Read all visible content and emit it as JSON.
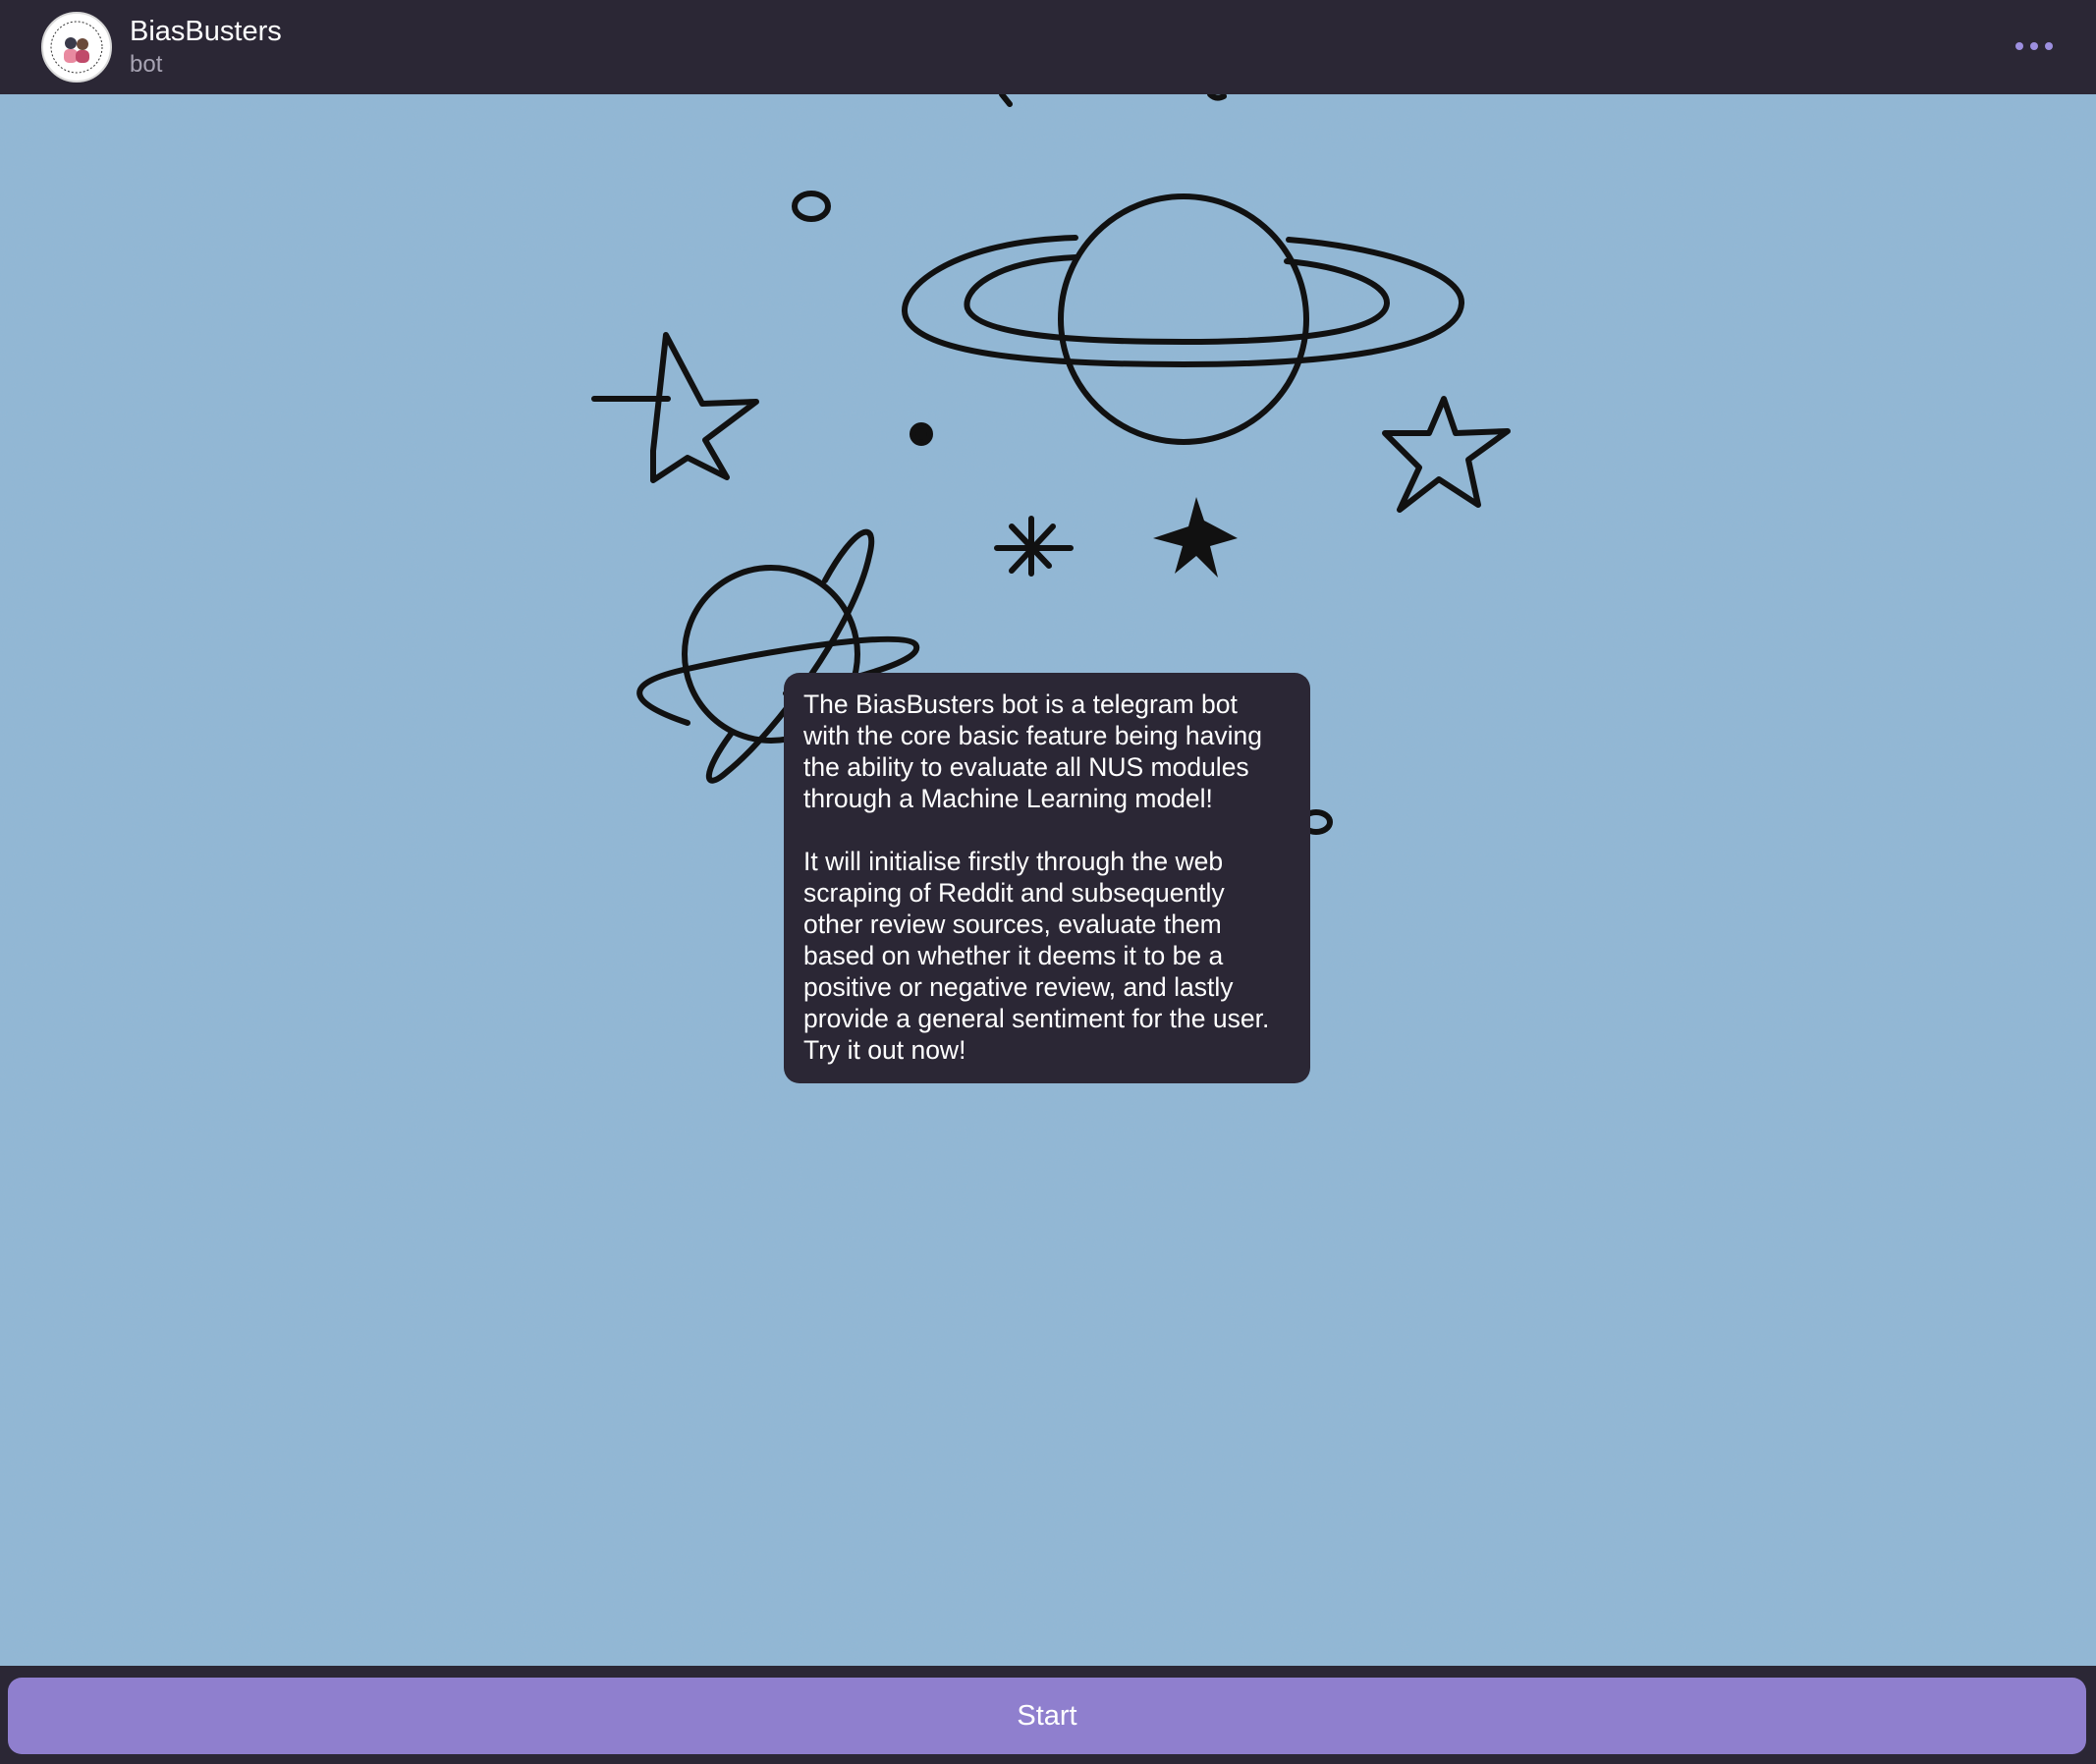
{
  "header": {
    "title": "BiasBusters",
    "subtitle": "bot",
    "avatar_icon": "biasbusters-logo-icon",
    "menu_icon": "more-horizontal-icon"
  },
  "chat": {
    "wallpaper": "space-doodle-pattern",
    "messages": [
      {
        "text": "The BiasBusters bot is a telegram bot with the core basic feature being having the ability to evaluate all NUS modules through a Machine Learning model!\n\nIt will initialise firstly through the web scraping of Reddit and subsequently other review sources, evaluate them based on whether it deems it to be a positive or negative review, and lastly provide a general sentiment for the user. Try it out now!"
      }
    ]
  },
  "footer": {
    "start_label": "Start"
  },
  "colors": {
    "header_bg": "#2b2735",
    "chat_bg": "#8fb8d6",
    "bubble_bg": "#2b2735",
    "accent": "#8f7fce",
    "menu_dots": "#9d8fe0"
  }
}
